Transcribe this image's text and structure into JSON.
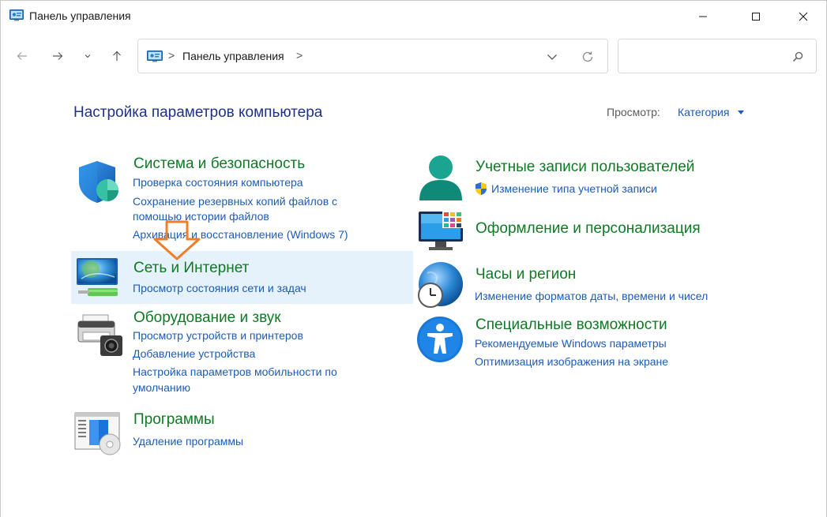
{
  "window": {
    "title": "Панель управления"
  },
  "address": {
    "path": "Панель управления",
    "sep": ">"
  },
  "search": {
    "placeholder": ""
  },
  "page": {
    "title": "Настройка параметров компьютера",
    "view_label": "Просмотр:",
    "view_value": "Категория"
  },
  "categories": {
    "system": {
      "title": "Система и безопасность",
      "links": [
        "Проверка состояния компьютера",
        "Сохранение резервных копий файлов с",
        "помощью истории файлов",
        "Архивация и восстановление (Windows 7)"
      ]
    },
    "network": {
      "title": "Сеть и Интернет",
      "links": [
        "Просмотр состояния сети и задач"
      ]
    },
    "hardware": {
      "title": "Оборудование и звук",
      "links": [
        "Просмотр устройств и принтеров",
        "Добавление устройства",
        "Настройка параметров мобильности по",
        "умолчанию"
      ]
    },
    "programs": {
      "title": "Программы",
      "links": [
        "Удаление программы"
      ]
    },
    "accounts": {
      "title": "Учетные записи пользователей",
      "links": [
        "Изменение типа учетной записи"
      ]
    },
    "appearance": {
      "title": "Оформление и персонализация",
      "links": []
    },
    "clock": {
      "title": "Часы и регион",
      "links": [
        "Изменение форматов даты, времени и чисел"
      ]
    },
    "access": {
      "title": "Специальные возможности",
      "links": [
        "Рекомендуемые Windows параметры",
        "Оптимизация изображения на экране"
      ]
    }
  },
  "icons": {
    "shield": "shield-icon",
    "network": "network-globe-icon",
    "printer": "printer-icon",
    "programs": "programs-icon",
    "user": "user-icon",
    "display": "display-icon",
    "clock": "clock-globe-icon",
    "accessibility": "accessibility-icon",
    "uac": "uac-shield-icon"
  },
  "colors": {
    "category_title": "#0e7a24",
    "link": "#1e5bb4",
    "heading": "#1e3287",
    "hover": "#e5f1fb",
    "annotation_arrow": "#f07d28"
  }
}
